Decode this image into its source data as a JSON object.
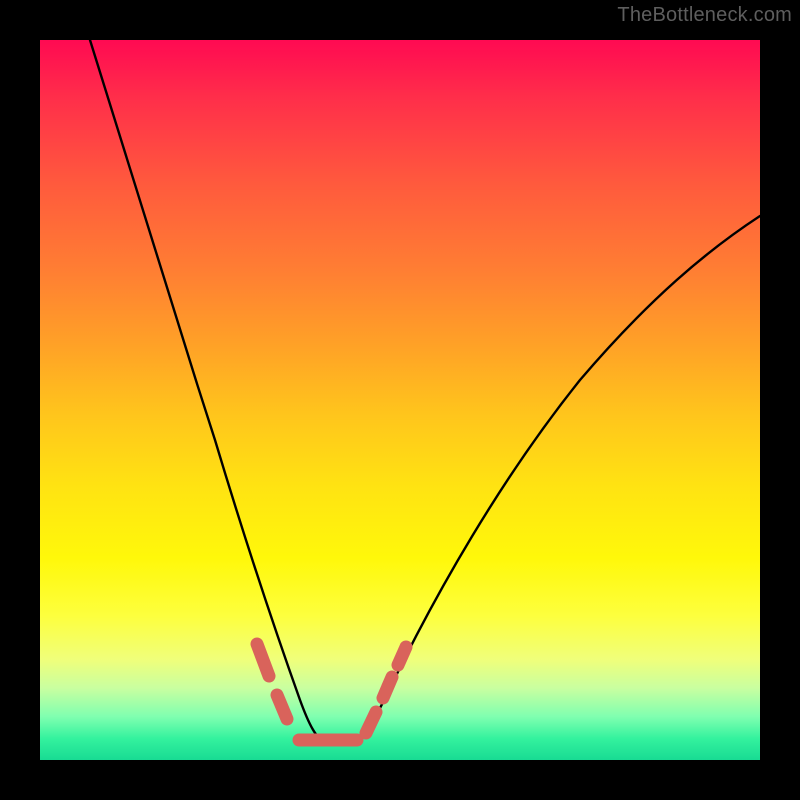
{
  "watermark": {
    "text": "TheBottleneck.com"
  },
  "chart_data": {
    "type": "line",
    "title": "",
    "xlabel": "",
    "ylabel": "",
    "xlim": [
      0,
      100
    ],
    "ylim": [
      0,
      100
    ],
    "grid": false,
    "legend": false,
    "background_gradient": [
      {
        "pos": 0.0,
        "color": "#ff0a52"
      },
      {
        "pos": 0.5,
        "color": "#ffd018"
      },
      {
        "pos": 0.82,
        "color": "#fbff3a"
      },
      {
        "pos": 1.0,
        "color": "#18db93"
      }
    ],
    "series": [
      {
        "name": "bottleneck-curve",
        "stroke": "#000000",
        "x": [
          7,
          10,
          14,
          18,
          22,
          26,
          29.5,
          32,
          34,
          36,
          37.5,
          39,
          44,
          46,
          48,
          50,
          53,
          57,
          62,
          68,
          75,
          83,
          92,
          100
        ],
        "y": [
          100,
          90,
          78,
          66,
          54,
          42,
          31,
          23,
          16,
          10,
          6,
          3,
          3,
          5,
          9,
          14,
          21,
          30,
          40,
          49,
          58,
          65,
          71,
          76
        ]
      },
      {
        "name": "marker-band",
        "stroke": "#d9635b",
        "marker": "round-cap-thick",
        "x": [
          30.5,
          33,
          36,
          39,
          43.5,
          46.5,
          48.5,
          50.5
        ],
        "y": [
          14,
          8,
          3,
          2.8,
          3,
          6,
          10,
          14
        ]
      }
    ]
  }
}
